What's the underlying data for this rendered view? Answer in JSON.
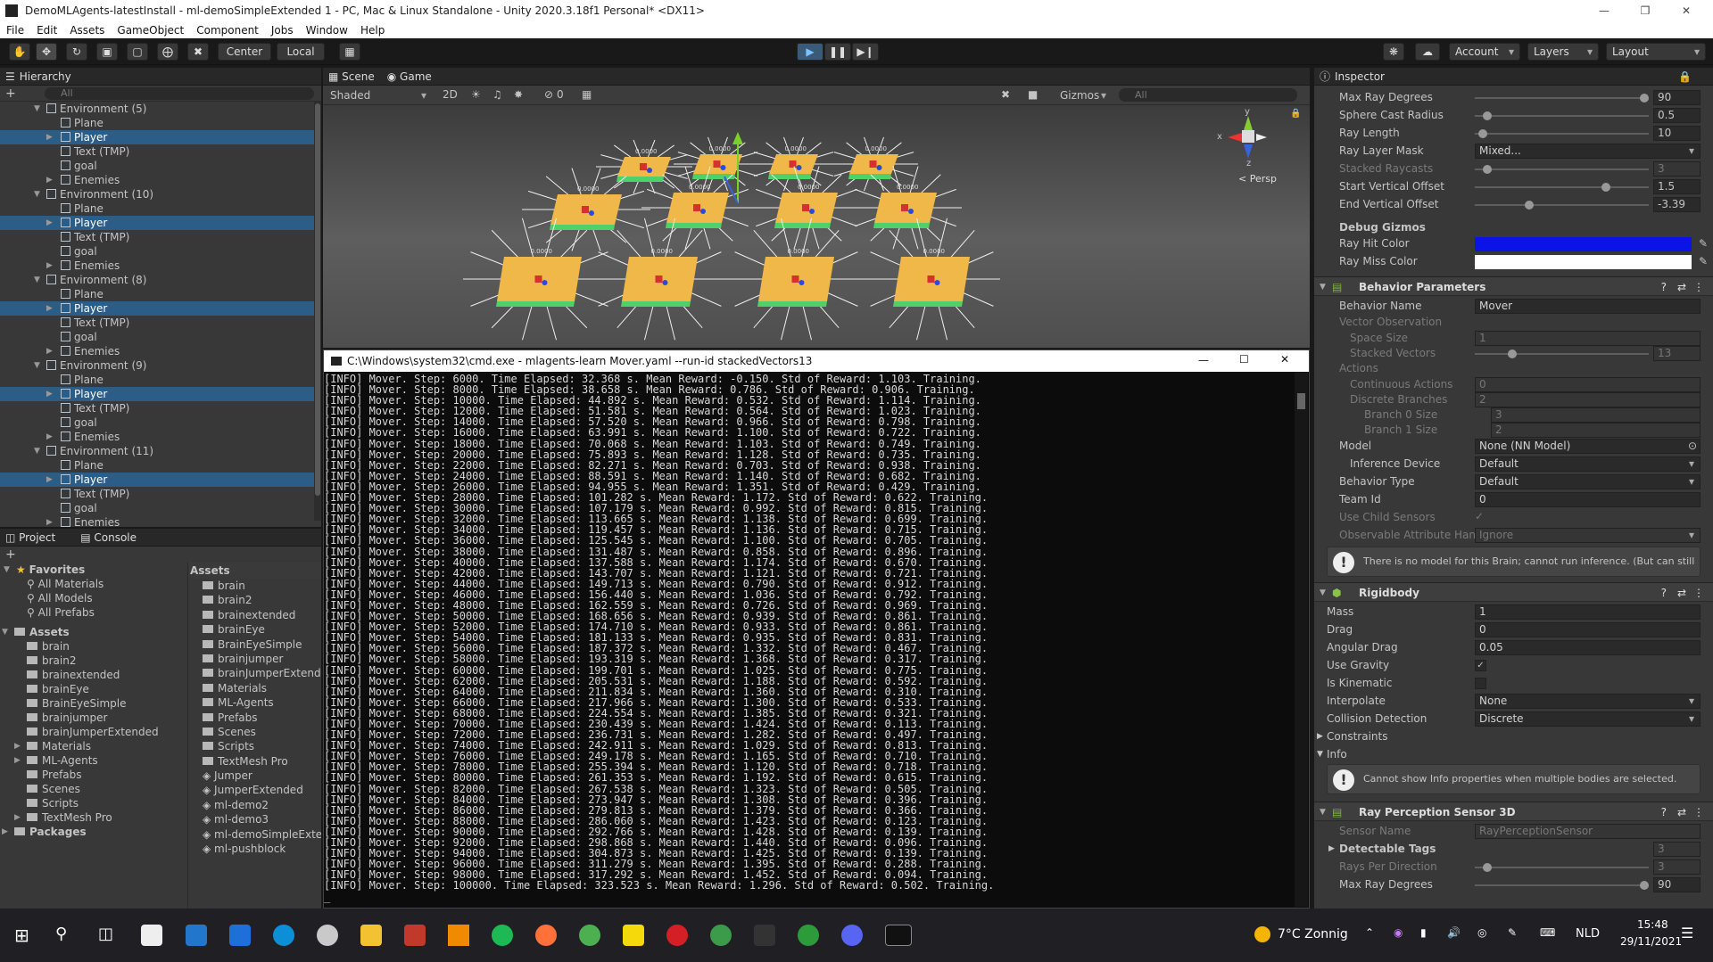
{
  "title": "DemoMLAgents-latestInstall - ml-demoSimpleExtended 1 - PC, Mac & Linux Standalone - Unity 2020.3.18f1 Personal* <DX11>",
  "menu": [
    "File",
    "Edit",
    "Assets",
    "GameObject",
    "Component",
    "Jobs",
    "Window",
    "Help"
  ],
  "toolbar": {
    "center": "Center",
    "local": "Local",
    "account": "Account",
    "layers": "Layers",
    "layout": "Layout"
  },
  "hierarchy": {
    "tab": "Hierarchy",
    "search": "All",
    "rows": [
      {
        "label": "Environment (5)",
        "lvl": 1,
        "sel": false,
        "exp": true
      },
      {
        "label": "Plane",
        "lvl": 2,
        "sel": false
      },
      {
        "label": "Player",
        "lvl": 2,
        "sel": true
      },
      {
        "label": "Text (TMP)",
        "lvl": 2,
        "sel": false
      },
      {
        "label": "goal",
        "lvl": 2,
        "sel": false
      },
      {
        "label": "Enemies",
        "lvl": 2,
        "sel": false
      },
      {
        "label": "Environment (10)",
        "lvl": 1,
        "sel": false,
        "exp": true
      },
      {
        "label": "Plane",
        "lvl": 2,
        "sel": false
      },
      {
        "label": "Player",
        "lvl": 2,
        "sel": true
      },
      {
        "label": "Text (TMP)",
        "lvl": 2,
        "sel": false
      },
      {
        "label": "goal",
        "lvl": 2,
        "sel": false
      },
      {
        "label": "Enemies",
        "lvl": 2,
        "sel": false
      },
      {
        "label": "Environment (8)",
        "lvl": 1,
        "sel": false,
        "exp": true
      },
      {
        "label": "Plane",
        "lvl": 2,
        "sel": false
      },
      {
        "label": "Player",
        "lvl": 2,
        "sel": true
      },
      {
        "label": "Text (TMP)",
        "lvl": 2,
        "sel": false
      },
      {
        "label": "goal",
        "lvl": 2,
        "sel": false
      },
      {
        "label": "Enemies",
        "lvl": 2,
        "sel": false
      },
      {
        "label": "Environment (9)",
        "lvl": 1,
        "sel": false,
        "exp": true
      },
      {
        "label": "Plane",
        "lvl": 2,
        "sel": false
      },
      {
        "label": "Player",
        "lvl": 2,
        "sel": true
      },
      {
        "label": "Text (TMP)",
        "lvl": 2,
        "sel": false
      },
      {
        "label": "goal",
        "lvl": 2,
        "sel": false
      },
      {
        "label": "Enemies",
        "lvl": 2,
        "sel": false
      },
      {
        "label": "Environment (11)",
        "lvl": 1,
        "sel": false,
        "exp": true
      },
      {
        "label": "Plane",
        "lvl": 2,
        "sel": false
      },
      {
        "label": "Player",
        "lvl": 2,
        "sel": true
      },
      {
        "label": "Text (TMP)",
        "lvl": 2,
        "sel": false
      },
      {
        "label": "goal",
        "lvl": 2,
        "sel": false
      },
      {
        "label": "Enemies",
        "lvl": 2,
        "sel": false
      }
    ]
  },
  "project": {
    "tab_project": "Project",
    "tab_console": "Console",
    "favorites": "Favorites",
    "fav_items": [
      "All Materials",
      "All Models",
      "All Prefabs"
    ],
    "assets_root": "Assets",
    "tree": [
      "brain",
      "brain2",
      "brainextended",
      "brainEye",
      "BrainEyeSimple",
      "brainjumper",
      "brainJumperExtended",
      "Materials",
      "ML-Agents",
      "Prefabs",
      "Scenes",
      "Scripts",
      "TextMesh Pro"
    ],
    "packages": "Packages",
    "assets_header": "Assets",
    "folders": [
      "brain",
      "brain2",
      "brainextended",
      "brainEye",
      "BrainEyeSimple",
      "brainjumper",
      "brainJumperExtended",
      "Materials",
      "ML-Agents",
      "Prefabs",
      "Scenes",
      "Scripts",
      "TextMesh Pro"
    ],
    "files": [
      "Jumper",
      "JumperExtended",
      "ml-demo2",
      "ml-demo3",
      "ml-demoSimpleExtended",
      "ml-pushblock"
    ]
  },
  "scene": {
    "tab_scene": "Scene",
    "tab_game": "Game",
    "shading": "Shaded",
    "mode2d": "2D",
    "fx_count": "0",
    "gizmos": "Gizmos",
    "search": "All",
    "persp": "< Persp",
    "axis_y": "y",
    "axis_x": "x",
    "axis_z": "z",
    "plat_label": "0.0000"
  },
  "cmd": {
    "title": "C:\\Windows\\system32\\cmd.exe - mlagents-learn  Mover.yaml --run-id stackedVectors13",
    "lines": [
      "[INFO] Mover. Step: 6000. Time Elapsed: 32.368 s. Mean Reward: -0.150. Std of Reward: 1.103. Training.",
      "[INFO] Mover. Step: 8000. Time Elapsed: 38.658 s. Mean Reward: 0.786. Std of Reward: 0.906. Training.",
      "[INFO] Mover. Step: 10000. Time Elapsed: 44.892 s. Mean Reward: 0.532. Std of Reward: 1.114. Training.",
      "[INFO] Mover. Step: 12000. Time Elapsed: 51.581 s. Mean Reward: 0.564. Std of Reward: 1.023. Training.",
      "[INFO] Mover. Step: 14000. Time Elapsed: 57.520 s. Mean Reward: 0.966. Std of Reward: 0.798. Training.",
      "[INFO] Mover. Step: 16000. Time Elapsed: 63.991 s. Mean Reward: 1.100. Std of Reward: 0.722. Training.",
      "[INFO] Mover. Step: 18000. Time Elapsed: 70.068 s. Mean Reward: 1.103. Std of Reward: 0.749. Training.",
      "[INFO] Mover. Step: 20000. Time Elapsed: 75.893 s. Mean Reward: 1.128. Std of Reward: 0.735. Training.",
      "[INFO] Mover. Step: 22000. Time Elapsed: 82.271 s. Mean Reward: 0.703. Std of Reward: 0.938. Training.",
      "[INFO] Mover. Step: 24000. Time Elapsed: 88.591 s. Mean Reward: 1.140. Std of Reward: 0.682. Training.",
      "[INFO] Mover. Step: 26000. Time Elapsed: 94.955 s. Mean Reward: 1.351. Std of Reward: 0.429. Training.",
      "[INFO] Mover. Step: 28000. Time Elapsed: 101.282 s. Mean Reward: 1.172. Std of Reward: 0.622. Training.",
      "[INFO] Mover. Step: 30000. Time Elapsed: 107.179 s. Mean Reward: 0.992. Std of Reward: 0.815. Training.",
      "[INFO] Mover. Step: 32000. Time Elapsed: 113.665 s. Mean Reward: 1.138. Std of Reward: 0.699. Training.",
      "[INFO] Mover. Step: 34000. Time Elapsed: 119.457 s. Mean Reward: 1.136. Std of Reward: 0.715. Training.",
      "[INFO] Mover. Step: 36000. Time Elapsed: 125.545 s. Mean Reward: 1.100. Std of Reward: 0.705. Training.",
      "[INFO] Mover. Step: 38000. Time Elapsed: 131.487 s. Mean Reward: 0.858. Std of Reward: 0.896. Training.",
      "[INFO] Mover. Step: 40000. Time Elapsed: 137.588 s. Mean Reward: 1.174. Std of Reward: 0.670. Training.",
      "[INFO] Mover. Step: 42000. Time Elapsed: 143.707 s. Mean Reward: 1.121. Std of Reward: 0.721. Training.",
      "[INFO] Mover. Step: 44000. Time Elapsed: 149.713 s. Mean Reward: 0.790. Std of Reward: 0.912. Training.",
      "[INFO] Mover. Step: 46000. Time Elapsed: 156.440 s. Mean Reward: 1.036. Std of Reward: 0.792. Training.",
      "[INFO] Mover. Step: 48000. Time Elapsed: 162.559 s. Mean Reward: 0.726. Std of Reward: 0.969. Training.",
      "[INFO] Mover. Step: 50000. Time Elapsed: 168.656 s. Mean Reward: 0.939. Std of Reward: 0.861. Training.",
      "[INFO] Mover. Step: 52000. Time Elapsed: 174.710 s. Mean Reward: 0.933. Std of Reward: 0.861. Training.",
      "[INFO] Mover. Step: 54000. Time Elapsed: 181.133 s. Mean Reward: 0.935. Std of Reward: 0.831. Training.",
      "[INFO] Mover. Step: 56000. Time Elapsed: 187.372 s. Mean Reward: 1.332. Std of Reward: 0.467. Training.",
      "[INFO] Mover. Step: 58000. Time Elapsed: 193.319 s. Mean Reward: 1.368. Std of Reward: 0.317. Training.",
      "[INFO] Mover. Step: 60000. Time Elapsed: 199.701 s. Mean Reward: 1.025. Std of Reward: 0.775. Training.",
      "[INFO] Mover. Step: 62000. Time Elapsed: 205.531 s. Mean Reward: 1.188. Std of Reward: 0.592. Training.",
      "[INFO] Mover. Step: 64000. Time Elapsed: 211.834 s. Mean Reward: 1.360. Std of Reward: 0.310. Training.",
      "[INFO] Mover. Step: 66000. Time Elapsed: 217.966 s. Mean Reward: 1.300. Std of Reward: 0.533. Training.",
      "[INFO] Mover. Step: 68000. Time Elapsed: 224.554 s. Mean Reward: 1.385. Std of Reward: 0.321. Training.",
      "[INFO] Mover. Step: 70000. Time Elapsed: 230.439 s. Mean Reward: 1.424. Std of Reward: 0.113. Training.",
      "[INFO] Mover. Step: 72000. Time Elapsed: 236.731 s. Mean Reward: 1.282. Std of Reward: 0.497. Training.",
      "[INFO] Mover. Step: 74000. Time Elapsed: 242.911 s. Mean Reward: 1.029. Std of Reward: 0.813. Training.",
      "[INFO] Mover. Step: 76000. Time Elapsed: 249.178 s. Mean Reward: 1.165. Std of Reward: 0.710. Training.",
      "[INFO] Mover. Step: 78000. Time Elapsed: 255.394 s. Mean Reward: 1.120. Std of Reward: 0.718. Training.",
      "[INFO] Mover. Step: 80000. Time Elapsed: 261.353 s. Mean Reward: 1.192. Std of Reward: 0.615. Training.",
      "[INFO] Mover. Step: 82000. Time Elapsed: 267.538 s. Mean Reward: 1.323. Std of Reward: 0.505. Training.",
      "[INFO] Mover. Step: 84000. Time Elapsed: 273.947 s. Mean Reward: 1.308. Std of Reward: 0.396. Training.",
      "[INFO] Mover. Step: 86000. Time Elapsed: 279.813 s. Mean Reward: 1.379. Std of Reward: 0.366. Training.",
      "[INFO] Mover. Step: 88000. Time Elapsed: 286.060 s. Mean Reward: 1.423. Std of Reward: 0.123. Training.",
      "[INFO] Mover. Step: 90000. Time Elapsed: 292.766 s. Mean Reward: 1.428. Std of Reward: 0.139. Training.",
      "[INFO] Mover. Step: 92000. Time Elapsed: 298.868 s. Mean Reward: 1.440. Std of Reward: 0.096. Training.",
      "[INFO] Mover. Step: 94000. Time Elapsed: 304.873 s. Mean Reward: 1.425. Std of Reward: 0.139. Training.",
      "[INFO] Mover. Step: 96000. Time Elapsed: 311.279 s. Mean Reward: 1.395. Std of Reward: 0.288. Training.",
      "[INFO] Mover. Step: 98000. Time Elapsed: 317.292 s. Mean Reward: 1.452. Std of Reward: 0.094. Training.",
      "[INFO] Mover. Step: 100000. Time Elapsed: 323.523 s. Mean Reward: 1.296. Std of Reward: 0.502. Training."
    ]
  },
  "inspector": {
    "tab": "Inspector",
    "top": [
      {
        "label": "Max Ray Degrees",
        "value": "90",
        "slider": 1.0
      },
      {
        "label": "Sphere Cast Radius",
        "value": "0.5",
        "slider": 0.05
      },
      {
        "label": "Ray Length",
        "value": "10",
        "slider": 0.02
      },
      {
        "label": "Ray Layer Mask",
        "value": "Mixed..."
      },
      {
        "label": "Stacked Raycasts",
        "value": "3",
        "slider": 0.05,
        "dim": true
      },
      {
        "label": "Start Vertical Offset",
        "value": "1.5",
        "slider": 0.77
      },
      {
        "label": "End Vertical Offset",
        "value": "-3.39",
        "slider": 0.3
      }
    ],
    "debug_gizmos": "Debug Gizmos",
    "ray_hit_color": "Ray Hit Color",
    "ray_miss_color": "Ray Miss Color",
    "hit_hex": "#0a14e6",
    "miss_hex": "#ffffff",
    "bp": {
      "header": "Behavior Parameters",
      "behavior_name_l": "Behavior Name",
      "behavior_name_v": "Mover",
      "vector_obs": "Vector Observation",
      "space_size_l": "Space Size",
      "space_size_v": "1",
      "stacked_l": "Stacked Vectors",
      "stacked_v": "13",
      "actions": "Actions",
      "cont_l": "Continuous Actions",
      "cont_v": "0",
      "disc_l": "Discrete Branches",
      "disc_v": "2",
      "b0_l": "Branch 0 Size",
      "b0_v": "3",
      "b1_l": "Branch 1 Size",
      "b1_v": "2",
      "model_l": "Model",
      "model_v": "None (NN Model)",
      "inf_l": "Inference Device",
      "inf_v": "Default",
      "btype_l": "Behavior Type",
      "btype_v": "Default",
      "team_l": "Team Id",
      "team_v": "0",
      "child_l": "Use Child Sensors",
      "obs_l": "Observable Attribute Hand",
      "obs_v": "Ignore",
      "help": "There is no model for this Brain; cannot run inference. (But can still train)"
    },
    "rb": {
      "header": "Rigidbody",
      "mass_l": "Mass",
      "mass_v": "1",
      "drag_l": "Drag",
      "drag_v": "0",
      "adrag_l": "Angular Drag",
      "adrag_v": "0.05",
      "grav_l": "Use Gravity",
      "kin_l": "Is Kinematic",
      "interp_l": "Interpolate",
      "interp_v": "None",
      "coll_l": "Collision Detection",
      "coll_v": "Discrete",
      "constraints": "Constraints",
      "info": "Info",
      "help": "Cannot show Info properties when multiple bodies are selected."
    },
    "rps": {
      "header": "Ray Perception Sensor 3D",
      "sensor_l": "Sensor Name",
      "sensor_v": "RayPerceptionSensor",
      "tags_l": "Detectable Tags",
      "tags_v": "3",
      "rays_l": "Rays Per Direction",
      "rays_v": "3",
      "maxdeg_l": "Max Ray Degrees",
      "maxdeg_v": "90"
    }
  },
  "taskbar": {
    "weather": "7°C  Zonnig",
    "lang": "NLD",
    "time": "15:48",
    "date": "29/11/2021"
  }
}
